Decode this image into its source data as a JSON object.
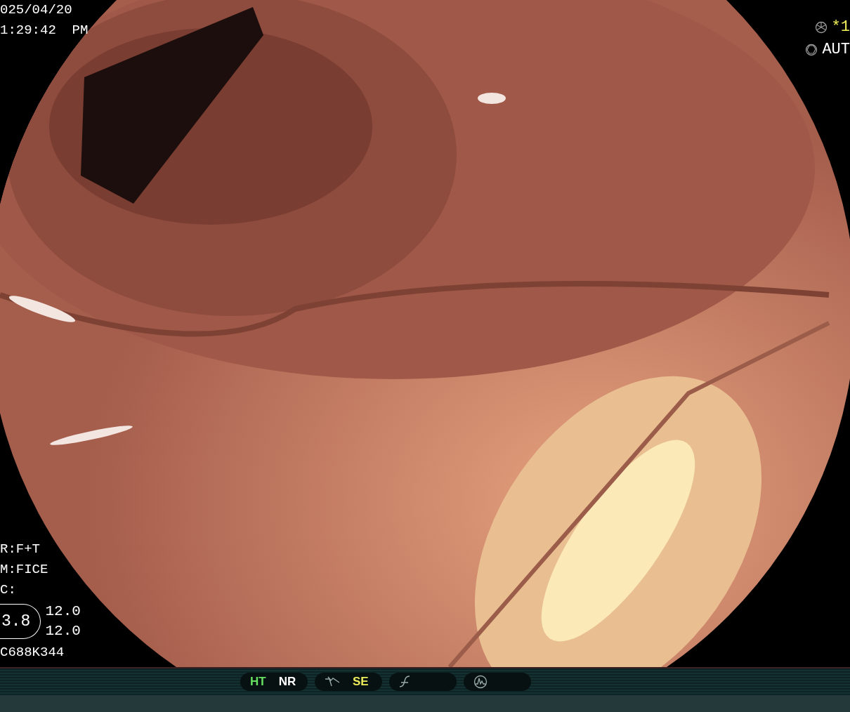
{
  "date": "025/04/20",
  "time": "1:29:42  PM",
  "top_right": [
    {
      "kind": "shutter",
      "text": "*1",
      "color": "#f2f25a"
    },
    {
      "kind": "aperture",
      "text": "AUT",
      "color": "#ffffff"
    }
  ],
  "settings": [
    "R:F+T",
    "M:FICE",
    "C:"
  ],
  "zoom": {
    "value": "3.8",
    "readings": [
      "12.0",
      "12.0"
    ]
  },
  "code": "C688K344",
  "indicator_groups": [
    {
      "items": [
        {
          "kind": "text",
          "text": "HT",
          "color": "#66e060"
        },
        {
          "kind": "text",
          "text": "NR",
          "color": "#ffffff"
        }
      ]
    },
    {
      "items": [
        {
          "kind": "step-icon"
        },
        {
          "kind": "text",
          "text": "SE",
          "color": "#ecec5a"
        }
      ]
    },
    {
      "items": [
        {
          "kind": "curve-icon"
        }
      ]
    },
    {
      "items": [
        {
          "kind": "wave-icon"
        }
      ]
    }
  ]
}
